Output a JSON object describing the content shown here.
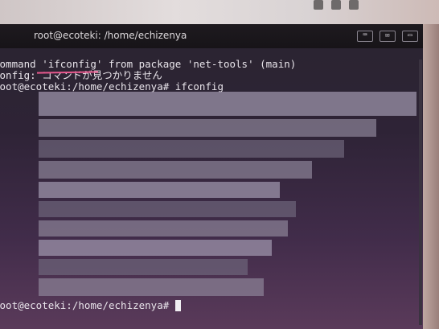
{
  "window": {
    "title": "root@ecoteki: /home/echizenya"
  },
  "terminal": {
    "lines": [
      "command 'ifconfig' from package 'net-tools' (main)",
      "config: コマンドが見つかりません",
      "root@ecoteki:/home/echizenya# ifconfig"
    ],
    "prompt": "root@ecoteki:/home/echizenya# "
  },
  "colors": {
    "underline": "#e7588d",
    "background": "#2e2336",
    "text": "#e8e4ea"
  },
  "icons": [
    "keyboard-icon",
    "mail-icon",
    "battery-icon"
  ]
}
